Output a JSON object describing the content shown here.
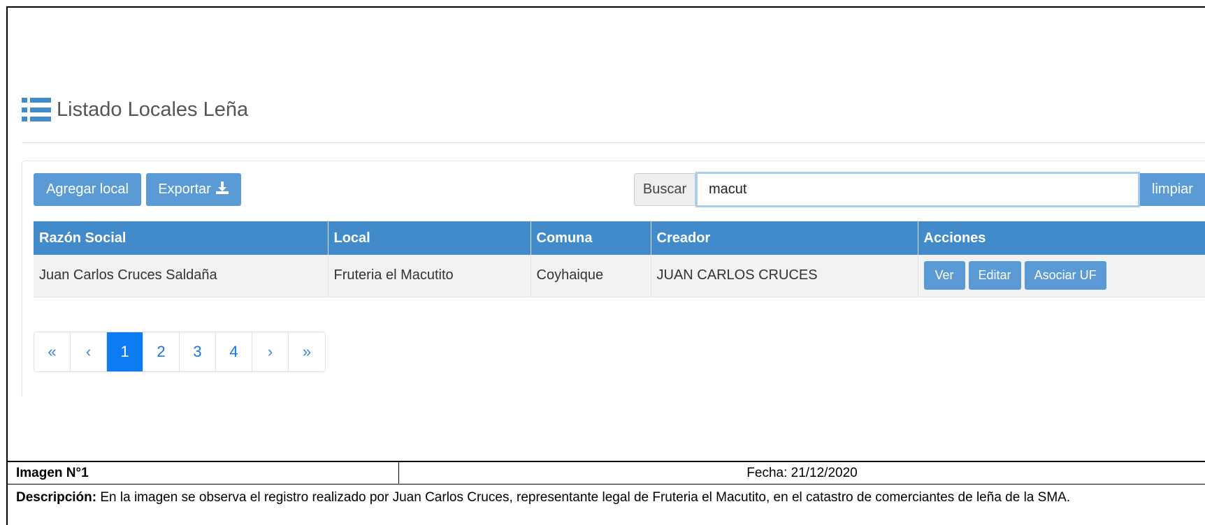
{
  "header": {
    "title": "Listado Locales Leña",
    "icon": "list-icon"
  },
  "toolbar": {
    "add_label": "Agregar local",
    "export_label": "Exportar",
    "export_icon": "download-icon"
  },
  "search": {
    "addon_label": "Buscar",
    "value": "macut",
    "clear_label": "limpiar"
  },
  "table": {
    "columns": [
      "Razón Social",
      "Local",
      "Comuna",
      "Creador",
      "Acciones"
    ],
    "rows": [
      {
        "razon_social": "Juan Carlos Cruces Saldaña",
        "local": "Fruteria el Macutito",
        "comuna": "Coyhaique",
        "creador": "JUAN CARLOS CRUCES",
        "actions": [
          "Ver",
          "Editar",
          "Asociar UF"
        ]
      }
    ]
  },
  "pagination": {
    "first": "«",
    "prev": "‹",
    "pages": [
      "1",
      "2",
      "3",
      "4"
    ],
    "active": "1",
    "next": "›",
    "last": "»"
  },
  "caption": {
    "image_label": "Imagen N°1",
    "date": "Fecha: 21/12/2020",
    "description_label": "Descripción:",
    "description": " En la imagen se observa el registro realizado por Juan Carlos Cruces, representante legal de Fruteria el Macutito, en el catastro de comerciantes de leña de la SMA."
  },
  "colors": {
    "primary": "#428bca",
    "button": "#5b9bd5",
    "active_page": "#0d7cf2"
  }
}
